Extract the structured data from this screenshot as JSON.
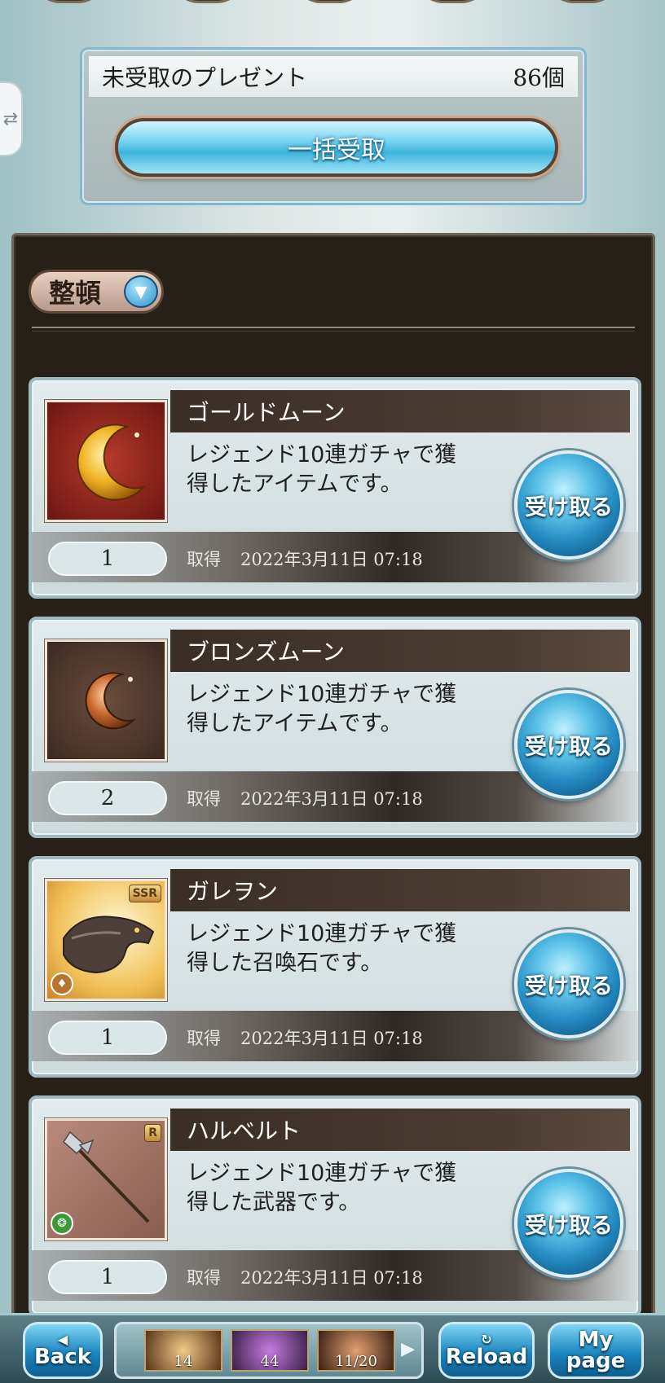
{
  "header": {
    "side_tab_icon": "swap-arrows-icon"
  },
  "summary": {
    "title": "未受取のプレゼント",
    "count": "86個",
    "bulk_button": "一括受取"
  },
  "panel": {
    "sort_label": "整頓",
    "sort_icon": "chevron-down-icon"
  },
  "items": [
    {
      "name": "ゴールドムーン",
      "desc_line1": "レジェンド10連ガチャで獲",
      "desc_line2": "得したアイテムです。",
      "quantity": "1",
      "acquired_label": "取得",
      "date": "2022年3月11日 07:18",
      "button": "受け取る",
      "thumb_icon": "gold-moon-icon"
    },
    {
      "name": "ブロンズムーン",
      "desc_line1": "レジェンド10連ガチャで獲",
      "desc_line2": "得したアイテムです。",
      "quantity": "2",
      "acquired_label": "取得",
      "date": "2022年3月11日 07:18",
      "button": "受け取る",
      "thumb_icon": "bronze-moon-icon"
    },
    {
      "name": "ガレヲン",
      "desc_line1": "レジェンド10連ガチャで獲",
      "desc_line2": "得した召喚石です。",
      "quantity": "1",
      "acquired_label": "取得",
      "date": "2022年3月11日 07:18",
      "button": "受け取る",
      "thumb_icon": "dragon-icon",
      "rarity": "SSR"
    },
    {
      "name": "ハルベルト",
      "desc_line1": "レジェンド10連ガチャで獲",
      "desc_line2": "得した武器です。",
      "quantity": "1",
      "acquired_label": "取得",
      "date": "2022年3月11日 07:18",
      "button": "受け取る",
      "thumb_icon": "halberd-icon",
      "rarity": "R"
    }
  ],
  "bottom_nav": {
    "back_label": "Back",
    "reload_label": "Reload",
    "mypage_label_1": "My",
    "mypage_label_2": "page",
    "slot1": "14",
    "slot2": "44",
    "slot3": "11/20"
  }
}
